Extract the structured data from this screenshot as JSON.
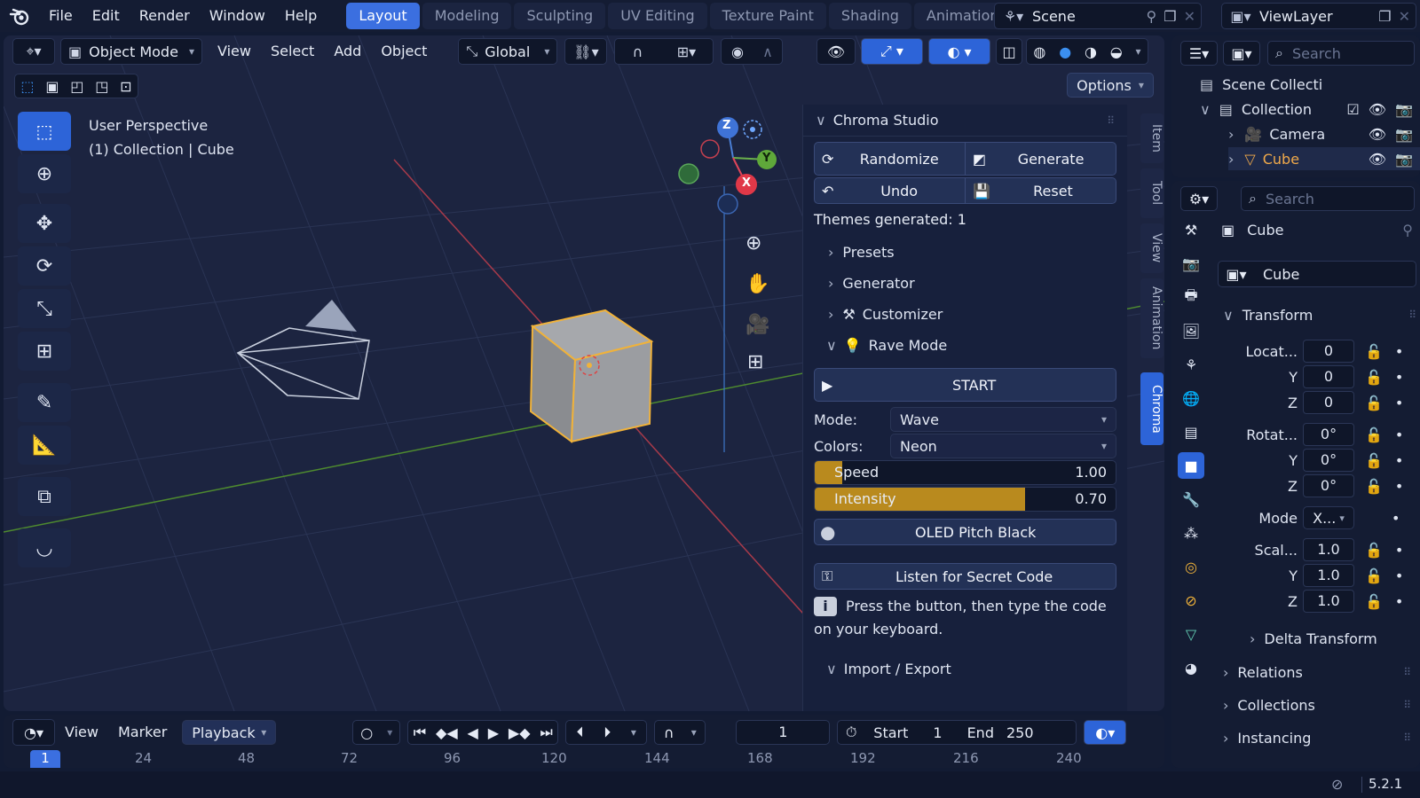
{
  "menu": {
    "items": [
      "File",
      "Edit",
      "Render",
      "Window",
      "Help"
    ],
    "workspaces": [
      "Layout",
      "Modeling",
      "Sculpting",
      "UV Editing",
      "Texture Paint",
      "Shading",
      "Animation"
    ],
    "scene": "Scene",
    "view_layer": "ViewLayer"
  },
  "viewport_header": {
    "mode": "Object Mode",
    "menus": [
      "View",
      "Select",
      "Add",
      "Object"
    ],
    "orientation": "Global",
    "options": "Options"
  },
  "viewport": {
    "perspective": "User Perspective",
    "context": "(1) Collection | Cube",
    "gizmo": {
      "x": "X",
      "y": "Y",
      "z": "Z"
    }
  },
  "chroma": {
    "title": "Chroma Studio",
    "randomize": "Randomize",
    "generate": "Generate",
    "undo": "Undo",
    "reset": "Reset",
    "themes_generated": "Themes generated: 1",
    "sections": [
      "Presets",
      "Generator",
      "Customizer",
      "Rave Mode"
    ],
    "start": "START",
    "mode_label": "Mode:",
    "mode_value": "Wave",
    "colors_label": "Colors:",
    "colors_value": "Neon",
    "speed_label": "Speed",
    "speed_value": "1.00",
    "speed_fraction": 0.09,
    "intensity_label": "Intensity",
    "intensity_value": "0.70",
    "intensity_fraction": 0.7,
    "oled": "OLED Pitch Black",
    "secret": "Listen for Secret Code",
    "hint_line1": "Press the button, then type the code",
    "hint_line2": "on your keyboard.",
    "import_export": "Import / Export"
  },
  "side_tabs": [
    "Item",
    "Tool",
    "View",
    "Animation",
    "Chroma"
  ],
  "timeline": {
    "menus": [
      "View",
      "Marker"
    ],
    "playback": "Playback",
    "current_frame": "1",
    "start_label": "Start",
    "start_value": "1",
    "end_label": "End",
    "end_value": "250",
    "ruler": [
      "1",
      "24",
      "48",
      "72",
      "96",
      "120",
      "144",
      "168",
      "192",
      "216",
      "240"
    ]
  },
  "outliner": {
    "search_placeholder": "Search",
    "scene_collection": "Scene Collecti",
    "collection": "Collection",
    "camera": "Camera",
    "cube": "Cube"
  },
  "properties": {
    "search_placeholder": "Search",
    "object_name": "Cube",
    "object_field": "Cube",
    "transform": "Transform",
    "location_label": "Locat...",
    "rotation_label": "Rotat...",
    "scale_label": "Scal...",
    "y": "Y",
    "z": "Z",
    "loc": [
      "0",
      "0",
      "0"
    ],
    "rot": [
      "0°",
      "0°",
      "0°"
    ],
    "scale": [
      "1.0",
      "1.0",
      "1.0"
    ],
    "mode_label": "Mode",
    "mode_value": "X...",
    "delta": "Delta Transform",
    "relations": "Relations",
    "collections": "Collections",
    "instancing": "Instancing"
  },
  "status": {
    "version": "5.2.1"
  },
  "colors": {
    "accent": "#3b6fe0",
    "selection": "#e7a12c",
    "slider": "#b98a1e"
  }
}
